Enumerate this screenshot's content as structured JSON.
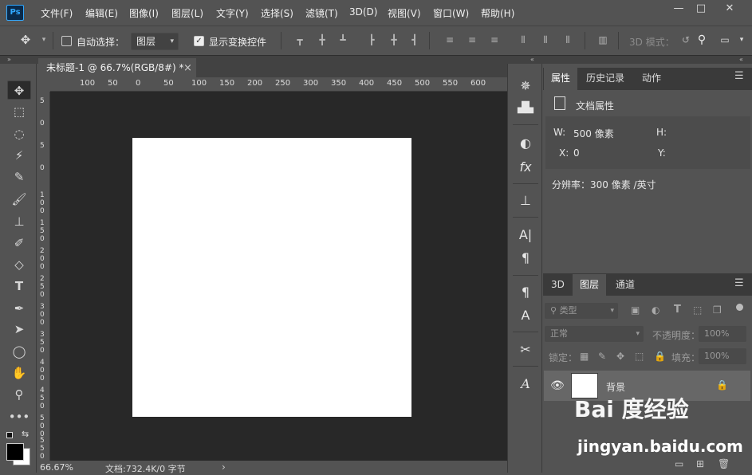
{
  "app": {
    "logo": "Ps"
  },
  "menu": [
    "文件(F)",
    "编辑(E)",
    "图像(I)",
    "图层(L)",
    "文字(Y)",
    "选择(S)",
    "滤镜(T)",
    "3D(D)",
    "视图(V)",
    "窗口(W)",
    "帮助(H)"
  ],
  "window_controls": {
    "minimize": "—",
    "restore": "□",
    "close": "✕"
  },
  "options": {
    "auto_select_label": "自动选择：",
    "auto_select_value": "图层",
    "show_transform_label": "显示变换控件",
    "mode_3d_label": "3D 模式："
  },
  "document": {
    "tab_title": "未标题-1 @ 66.7%(RGB/8#) *",
    "close": "×"
  },
  "ruler": {
    "h_ticks": [
      "100",
      "50",
      "0",
      "50",
      "100",
      "150",
      "200",
      "250",
      "300",
      "350",
      "400",
      "450",
      "500",
      "550",
      "600"
    ],
    "v_ticks": [
      "5",
      "0",
      "5",
      "0",
      "1\n0\n0",
      "1\n5\n0",
      "2\n0\n0",
      "2\n5\n0",
      "3\n0\n0",
      "3\n5\n0",
      "4\n0\n0",
      "4\n5\n0",
      "5\n0\n0",
      "5\n5\n0"
    ]
  },
  "status": {
    "zoom": "66.67%",
    "doc_info": "文档:732.4K/0 字节",
    "arrow": "›"
  },
  "properties_panel": {
    "tabs": [
      "属性",
      "历史记录",
      "动作"
    ],
    "heading": "文档属性",
    "w_label": "W:",
    "w_value": "500 像素",
    "h_label": "H:",
    "x_label": "X:",
    "x_value": "0",
    "y_label": "Y:",
    "resolution": "分辨率：300 像素 /英寸"
  },
  "layers_panel": {
    "tabs": [
      "3D",
      "图层",
      "通道"
    ],
    "filter_placeholder": "类型",
    "blend_mode": "正常",
    "opacity_label": "不透明度：",
    "opacity_value": "100%",
    "lock_label": "锁定：",
    "fill_label": "填充：",
    "fill_value": "100%",
    "layer_name": "背景"
  },
  "watermark": {
    "logo": "Bai 度经验",
    "url": "jingyan.baidu.com"
  }
}
